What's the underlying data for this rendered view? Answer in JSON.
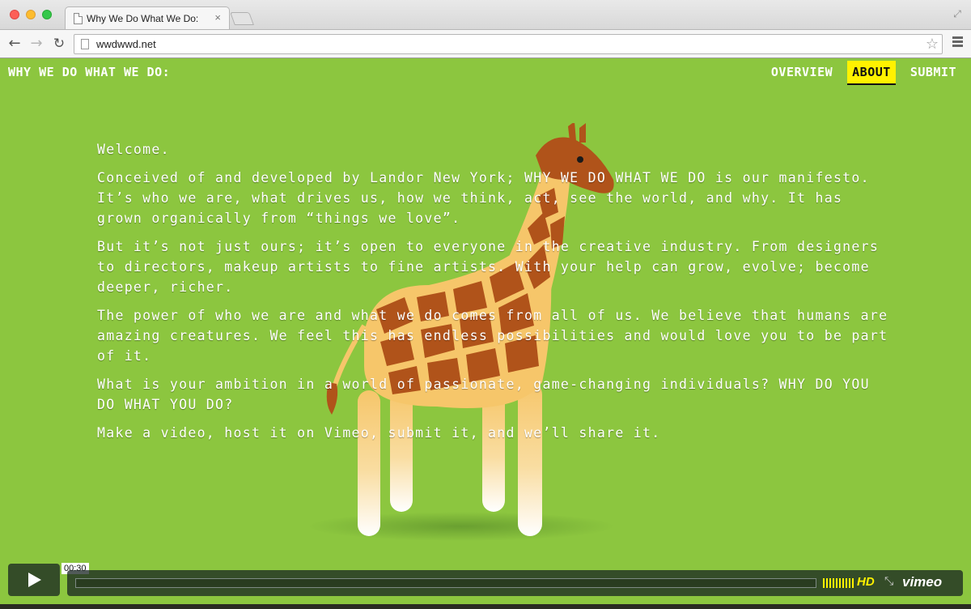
{
  "browser": {
    "tab_title": "Why We Do What We Do:",
    "tab_close": "×",
    "url": "wwdwwd.net"
  },
  "site": {
    "title": "WHY WE DO WHAT WE DO:",
    "nav": [
      {
        "label": "OVERVIEW",
        "active": false
      },
      {
        "label": "ABOUT",
        "active": true
      },
      {
        "label": "SUBMIT",
        "active": false
      }
    ],
    "paragraphs": [
      "Welcome.",
      "Conceived of and developed by Landor New York; WHY WE DO WHAT WE DO is our manifesto. It’s who we are, what drives us, how we think, act, see the world, and why. It has grown organically from “things we love”.",
      "But it’s not just ours; it’s open to everyone in the creative industry. From designers to directors, makeup artists to fine artists. With your help can grow, evolve; become deeper, richer.",
      "The power of who we are and what we do comes from all of us. We believe that humans are amazing creatures. We feel this has endless possibilities and would love you to be part of it.",
      "What is your ambition in a world of passionate, game-changing individuals? WHY DO YOU DO WHAT YOU DO?",
      "Make a video, host it on Vimeo, submit it, and we’ll share it."
    ]
  },
  "video": {
    "time": "00:30",
    "hd_label": "HD",
    "brand": "vimeo",
    "accent_color": "#fff200"
  },
  "colors": {
    "background": "#8cc63f",
    "nav_active": "#fff200"
  }
}
